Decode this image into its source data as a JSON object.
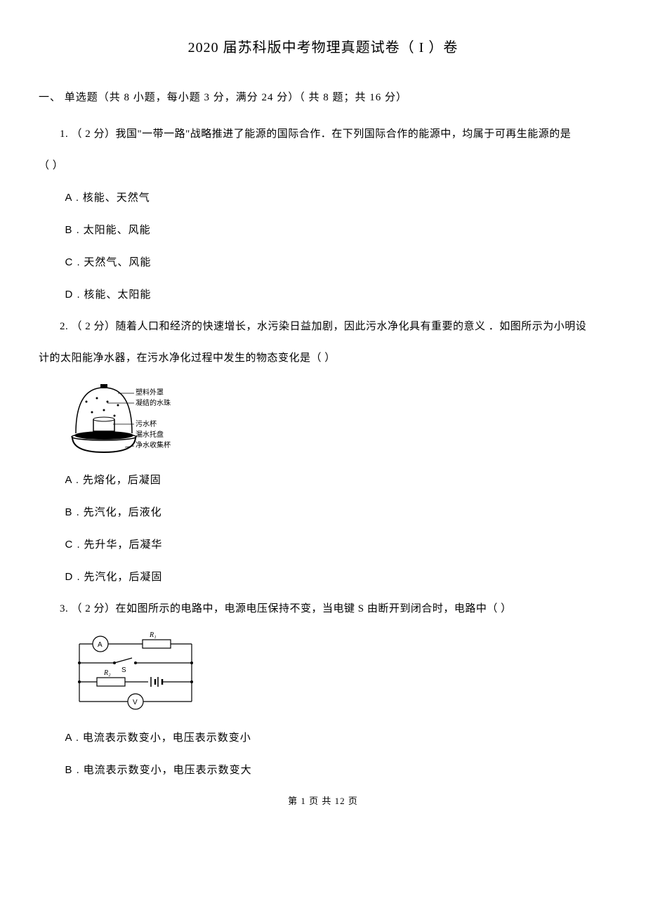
{
  "title": "2020 届苏科版中考物理真题试卷（  I ）卷",
  "section_header": "一、  单选题（共  8 小题，每小题   3 分，满分   24 分）（ 共 8 题；共  16 分）",
  "q1": {
    "stem_line1": "1.  （ 2 分）我国\"一带一路\"战略推进了能源的国际合作．在下列国际合作的能源中，均属于可再生能源的是",
    "stem_line2": "（          ）",
    "opt_a_label": "A .",
    "opt_a": "核能、天然气",
    "opt_b_label": "B .",
    "opt_b": "太阳能、风能",
    "opt_c_label": "C .",
    "opt_c": "天然气、风能",
    "opt_d_label": "D .",
    "opt_d": "核能、太阳能"
  },
  "q2": {
    "stem_line1": "2.  （ 2 分）随着人口和经济的快速增长，水污染日益加剧，因此污水净化具有重要的意义            ．如图所示为小明设",
    "stem_line2": "计的太阳能净水器，在污水净化过程中发生的物态变化是（                   ）",
    "figure_labels": [
      "塑料外罩",
      "凝结的水珠",
      "污水杯",
      "漏水托盘",
      "净水收集杯"
    ],
    "opt_a_label": "A .",
    "opt_a": "先熔化，后凝固",
    "opt_b_label": "B .",
    "opt_b": "先汽化，后液化",
    "opt_c_label": "C .",
    "opt_c": "先升华，后凝华",
    "opt_d_label": "D .",
    "opt_d": "先汽化，后凝固"
  },
  "q3": {
    "stem": "3.  （ 2 分）在如图所示的电路中，电源电压保持不变，当电键           S 由断开到闭合时，电路中（            ）",
    "figure_labels": [
      "A",
      "R₁",
      "S",
      "R₂",
      "V"
    ],
    "opt_a_label": "A .",
    "opt_a": "电流表示数变小，电压表示数变小",
    "opt_b_label": "B .",
    "opt_b": "电流表示数变小，电压表示数变大"
  },
  "footer": "第  1 页 共  12 页"
}
